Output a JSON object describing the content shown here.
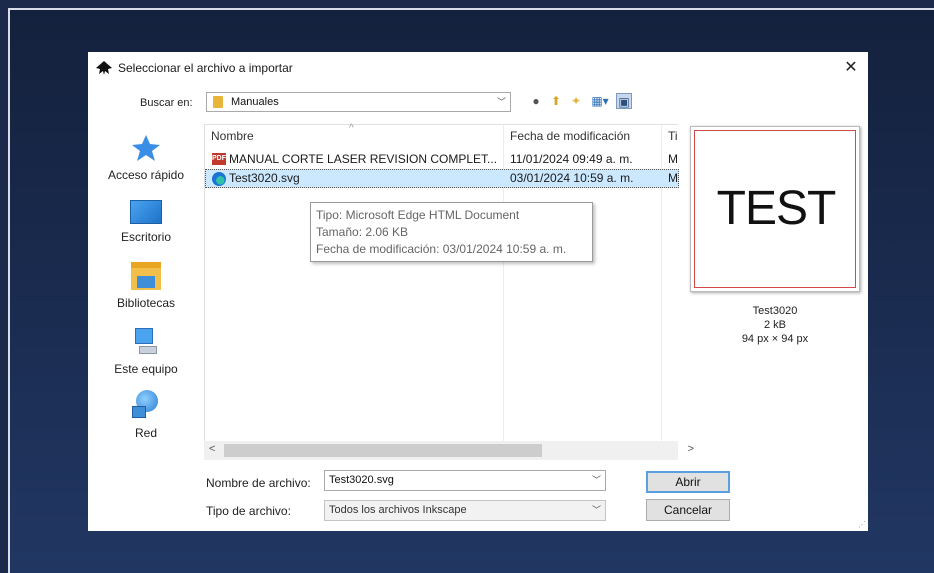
{
  "dialog": {
    "title": "Seleccionar el archivo a importar",
    "close_label": "✕"
  },
  "lookin": {
    "label": "Buscar en:",
    "value": "Manuales"
  },
  "places": [
    {
      "label": "Acceso rápido",
      "icon": "star-icon"
    },
    {
      "label": "Escritorio",
      "icon": "desktop-icon"
    },
    {
      "label": "Bibliotecas",
      "icon": "library-icon"
    },
    {
      "label": "Este equipo",
      "icon": "computer-icon"
    },
    {
      "label": "Red",
      "icon": "network-icon"
    }
  ],
  "filelist": {
    "columns": [
      "Nombre",
      "Fecha de modificación",
      "Ti"
    ],
    "rows": [
      {
        "name": "MANUAL CORTE LASER REVISION COMPLET...",
        "date": "11/01/2024 09:49 a. m.",
        "type": "M",
        "icon": "pdf-icon"
      },
      {
        "name": "Test3020.svg",
        "date": "03/01/2024 10:59 a. m.",
        "type": "M",
        "icon": "edge-icon",
        "selected": true
      }
    ]
  },
  "tooltip": {
    "type": "Tipo: Microsoft Edge HTML Document",
    "size": "Tamaño: 2.06 KB",
    "modified": "Fecha de modificación: 03/01/2024 10:59 a. m."
  },
  "preview": {
    "image_text": "TEST",
    "name": "Test3020",
    "size": "2 kB",
    "dims": "94 px × 94 px"
  },
  "filename": {
    "label": "Nombre de archivo:",
    "value": "Test3020.svg"
  },
  "filetype": {
    "label": "Tipo de archivo:",
    "value": "Todos los archivos Inkscape"
  },
  "buttons": {
    "open": "Abrir",
    "cancel": "Cancelar"
  },
  "colors": {
    "selection": "#cce8ff",
    "default_button_border": "#5aa0e0",
    "preview_border": "#d04a4a"
  }
}
